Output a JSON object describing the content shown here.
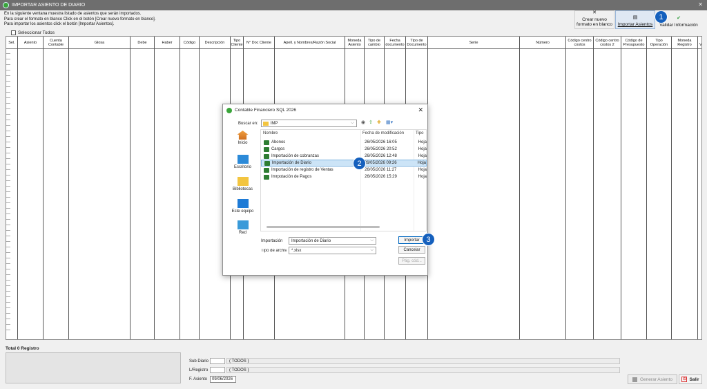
{
  "window": {
    "title": "IMPORTAR ASIENTO DE DIARIO"
  },
  "info": {
    "line1": "En la siguiente ventana muestra listado de asientos que serán importados.",
    "line2": "Para crear el formato en blanco Click en el botón  [Crear nuevo formato en blanco].",
    "line3": "Para importar los asientos click el botón  [Importar Asientos]."
  },
  "toolbar": {
    "crear_line1": "Crear nuevo",
    "crear_line2": "formato en blanco",
    "importar": "Importar Asientos",
    "validar": "Validar Información"
  },
  "select_all": "Seleccionar Todos",
  "grid": {
    "columns": [
      {
        "label": "Sel."
      },
      {
        "label": "Asiento"
      },
      {
        "label": "Cuenta Contable"
      },
      {
        "label": "Glosa"
      },
      {
        "label": "Debe"
      },
      {
        "label": "Haber"
      },
      {
        "label": "Código"
      },
      {
        "label": "Descripción"
      },
      {
        "label": "Tipo Cliente"
      },
      {
        "label": "N° Doc Cliente"
      },
      {
        "label": "Apell. y Nombres/Razón Social"
      },
      {
        "label": "Moneda Asiento"
      },
      {
        "label": "Tipo de cambio"
      },
      {
        "label": "Fecha documento"
      },
      {
        "label": "Tipo de Documento"
      },
      {
        "label": "Serie"
      },
      {
        "label": "Número"
      },
      {
        "label": "Código centro costos"
      },
      {
        "label": "Código centro costos 2"
      },
      {
        "label": "Código de Presupuesto"
      },
      {
        "label": "Tipo Operación"
      },
      {
        "label": "Moneda Registro"
      },
      {
        "label": "Fecha Vencimiento"
      }
    ]
  },
  "footer": {
    "total": "Total 0 Registro",
    "sub_diario_label": "Sub Diario",
    "sub_diario_value": "( TODOS )",
    "libro_label": "L/Registro",
    "libro_value": "( TODOS )",
    "fecha_label": "F. Asiento",
    "fecha_value": "09/06/2026",
    "generar": "Generar Asiento",
    "salir": "Salir"
  },
  "dialog": {
    "title": "Contable Financiero SQL 2026",
    "buscar_label": "Buscar en:",
    "folder": "IMP",
    "places": [
      "Inicio",
      "Escritorio",
      "Bibliotecas",
      "Este equipo",
      "Red"
    ],
    "headers": {
      "name": "Nombre",
      "date": "Fecha de modificación",
      "type": "Tipo"
    },
    "files": [
      {
        "name": "Abonos",
        "date": "26/05/2026 16:05",
        "type": "Hoja"
      },
      {
        "name": "Cargos",
        "date": "26/05/2026 20:52",
        "type": "Hoja"
      },
      {
        "name": "Importación de cobranzas",
        "date": "26/05/2026 12:48",
        "type": "Hoja"
      },
      {
        "name": "Importación de Diario",
        "date": "26/05/2026 09:26",
        "type": "Hoja"
      },
      {
        "name": "Importación de registro de Ventas",
        "date": "26/05/2026 11:27",
        "type": "Hoja"
      },
      {
        "name": "Imrpotación de Pagos",
        "date": "26/05/2026 15:29",
        "type": "Hoja"
      }
    ],
    "filename_label": "Importación",
    "filename_value": "Importación de Diario",
    "filetype_label": "Tipo de archivo:",
    "filetype_value": "*.xlsx",
    "btn_importar": "Importar",
    "btn_cancelar": "Cancelar",
    "btn_pag": "Pág. cód..."
  },
  "badges": [
    "1",
    "2",
    "3"
  ]
}
